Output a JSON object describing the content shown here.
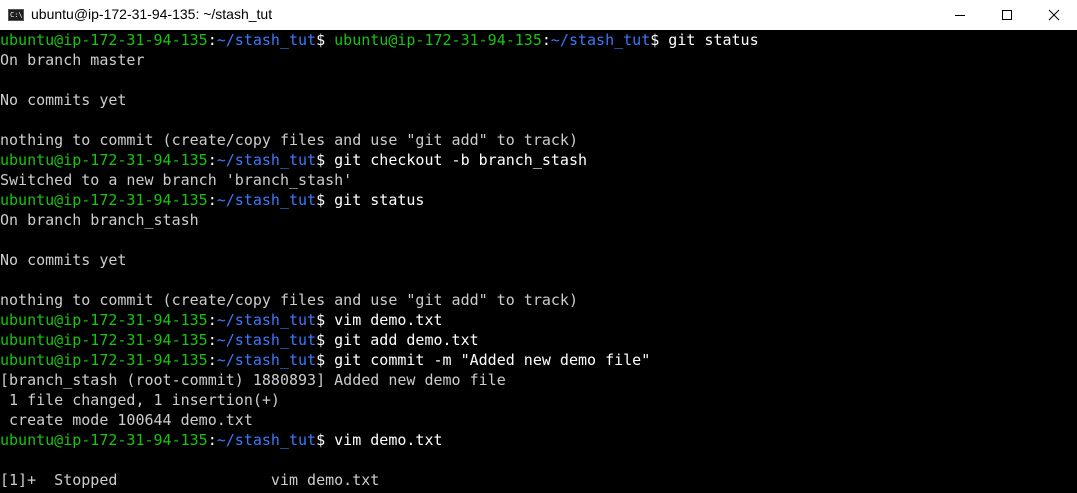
{
  "window": {
    "title": "ubuntu@ip-172-31-94-135: ~/stash_tut",
    "icon_glyph": "C:\\",
    "controls": [
      "minimize",
      "maximize",
      "close"
    ]
  },
  "colors": {
    "background": "#000000",
    "text": "#cccccc",
    "prompt_user": "#16c60c",
    "prompt_path": "#3b78ff",
    "titlebar": "#ffffff"
  },
  "prompt": {
    "user_host": "ubuntu@ip-172-31-94-135",
    "colon": ":",
    "path": "~/stash_tut",
    "symbol": "$ "
  },
  "terminal": {
    "lines": [
      {
        "type": "prompt",
        "command": "ubuntu@ip-172-31-94-135:~/stash_tut$ git status",
        "segments": [
          "ubuntu@ip-172-31-94-135",
          ":",
          "~/stash_tut",
          "$ ",
          "ubuntu@ip-172-31-94-135",
          ":",
          "~/stash_tut",
          "$ git status"
        ]
      },
      {
        "type": "output",
        "text": "On branch master"
      },
      {
        "type": "output",
        "text": ""
      },
      {
        "type": "output",
        "text": "No commits yet"
      },
      {
        "type": "output",
        "text": ""
      },
      {
        "type": "output",
        "text": "nothing to commit (create/copy files and use \"git add\" to track)"
      },
      {
        "type": "prompt",
        "command": "git checkout -b branch_stash"
      },
      {
        "type": "output",
        "text": "Switched to a new branch 'branch_stash'"
      },
      {
        "type": "prompt",
        "command": "git status"
      },
      {
        "type": "output",
        "text": "On branch branch_stash"
      },
      {
        "type": "output",
        "text": ""
      },
      {
        "type": "output",
        "text": "No commits yet"
      },
      {
        "type": "output",
        "text": ""
      },
      {
        "type": "output",
        "text": "nothing to commit (create/copy files and use \"git add\" to track)"
      },
      {
        "type": "prompt",
        "command": "vim demo.txt"
      },
      {
        "type": "prompt",
        "command": "git add demo.txt"
      },
      {
        "type": "prompt",
        "command": "git commit -m \"Added new demo file\""
      },
      {
        "type": "output",
        "text": "[branch_stash (root-commit) 1880893] Added new demo file"
      },
      {
        "type": "output",
        "text": " 1 file changed, 1 insertion(+)"
      },
      {
        "type": "output",
        "text": " create mode 100644 demo.txt"
      },
      {
        "type": "prompt",
        "command": "vim demo.txt"
      },
      {
        "type": "output",
        "text": ""
      },
      {
        "type": "output",
        "text": "[1]+  Stopped                 vim demo.txt"
      }
    ]
  }
}
